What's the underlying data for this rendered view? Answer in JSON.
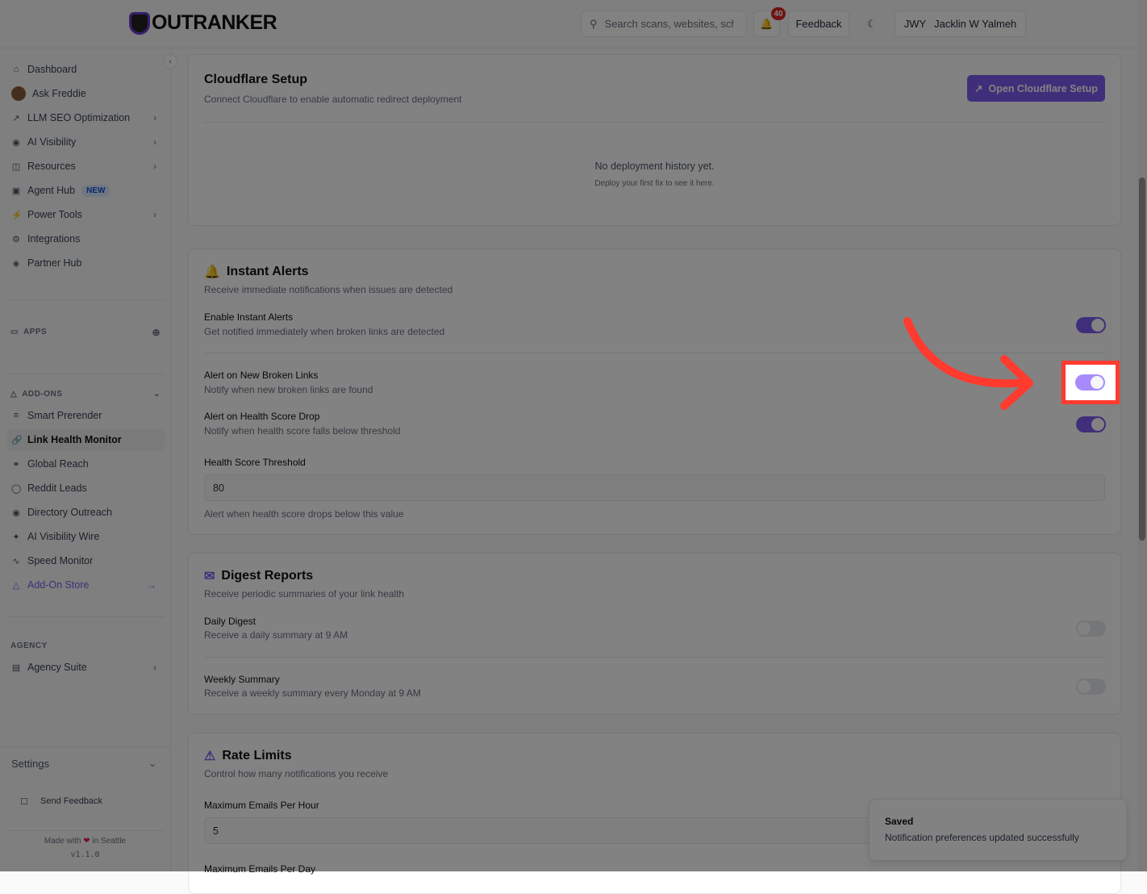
{
  "header": {
    "logo": "OUTRANKER",
    "search_placeholder": "Search scans, websites, schedules",
    "notifications": "40",
    "feedback": "Feedback",
    "user_initials": "JWY",
    "user_name": "Jacklin W Yalmeh"
  },
  "sidebar": {
    "items": [
      {
        "label": "Dashboard",
        "icon": "home-icon"
      },
      {
        "label": "Ask Freddie",
        "icon": "avatar"
      },
      {
        "label": "LLM SEO Optimization",
        "icon": "trend-icon",
        "chev": true
      },
      {
        "label": "AI Visibility",
        "icon": "eye-icon",
        "chev": true
      },
      {
        "label": "Resources",
        "icon": "book-icon",
        "chev": true
      },
      {
        "label": "Agent Hub",
        "icon": "bot-icon",
        "badge": "NEW"
      },
      {
        "label": "Power Tools",
        "icon": "bolt-icon",
        "chev": true
      },
      {
        "label": "Integrations",
        "icon": "gear-icon"
      },
      {
        "label": "Partner Hub",
        "icon": "handshake-icon"
      }
    ],
    "apps": "APPS",
    "addons": "ADD-ONS",
    "addon_items": [
      "Smart Prerender",
      "Link Health Monitor",
      "Global Reach",
      "Reddit Leads",
      "Directory Outreach",
      "AI Visibility Wire",
      "Speed Monitor"
    ],
    "store": "Add-On Store",
    "agency": "AGENCY",
    "agency_suite": "Agency Suite",
    "settings": "Settings",
    "send_feedback": "Send Feedback",
    "made_with_a": "Made with",
    "made_with_b": "in Seattle",
    "version": "v1.1.0"
  },
  "cloudflare": {
    "title": "Cloudflare Setup",
    "sub": "Connect Cloudflare to enable automatic redirect deployment",
    "button": "Open Cloudflare Setup",
    "empty_title": "No deployment history yet.",
    "empty_sub": "Deploy your first fix to see it here."
  },
  "alerts": {
    "title": "Instant Alerts",
    "sub": "Receive immediate notifications when issues are detected",
    "rows": [
      {
        "label": "Enable Instant Alerts",
        "desc": "Get notified immediately when broken links are detected",
        "on": true
      },
      {
        "label": "Alert on New Broken Links",
        "desc": "Notify when new broken links are found",
        "on": true
      },
      {
        "label": "Alert on Health Score Drop",
        "desc": "Notify when health score falls below threshold",
        "on": true
      }
    ],
    "threshold_label": "Health Score Threshold",
    "threshold_value": "80",
    "threshold_help": "Alert when health score drops below this value"
  },
  "digest": {
    "title": "Digest Reports",
    "sub": "Receive periodic summaries of your link health",
    "rows": [
      {
        "label": "Daily Digest",
        "desc": "Receive a daily summary at 9 AM",
        "on": false
      },
      {
        "label": "Weekly Summary",
        "desc": "Receive a weekly summary every Monday at 9 AM",
        "on": false
      }
    ]
  },
  "rate": {
    "title": "Rate Limits",
    "sub": "Control how many notifications you receive",
    "per_hour_label": "Maximum Emails Per Hour",
    "per_hour": "5",
    "per_day_label": "Maximum Emails Per Day"
  },
  "toast": {
    "title": "Saved",
    "message": "Notification preferences updated successfully"
  },
  "colors": {
    "accent": "#7c5cf0",
    "highlight": "#ff3b2f"
  }
}
